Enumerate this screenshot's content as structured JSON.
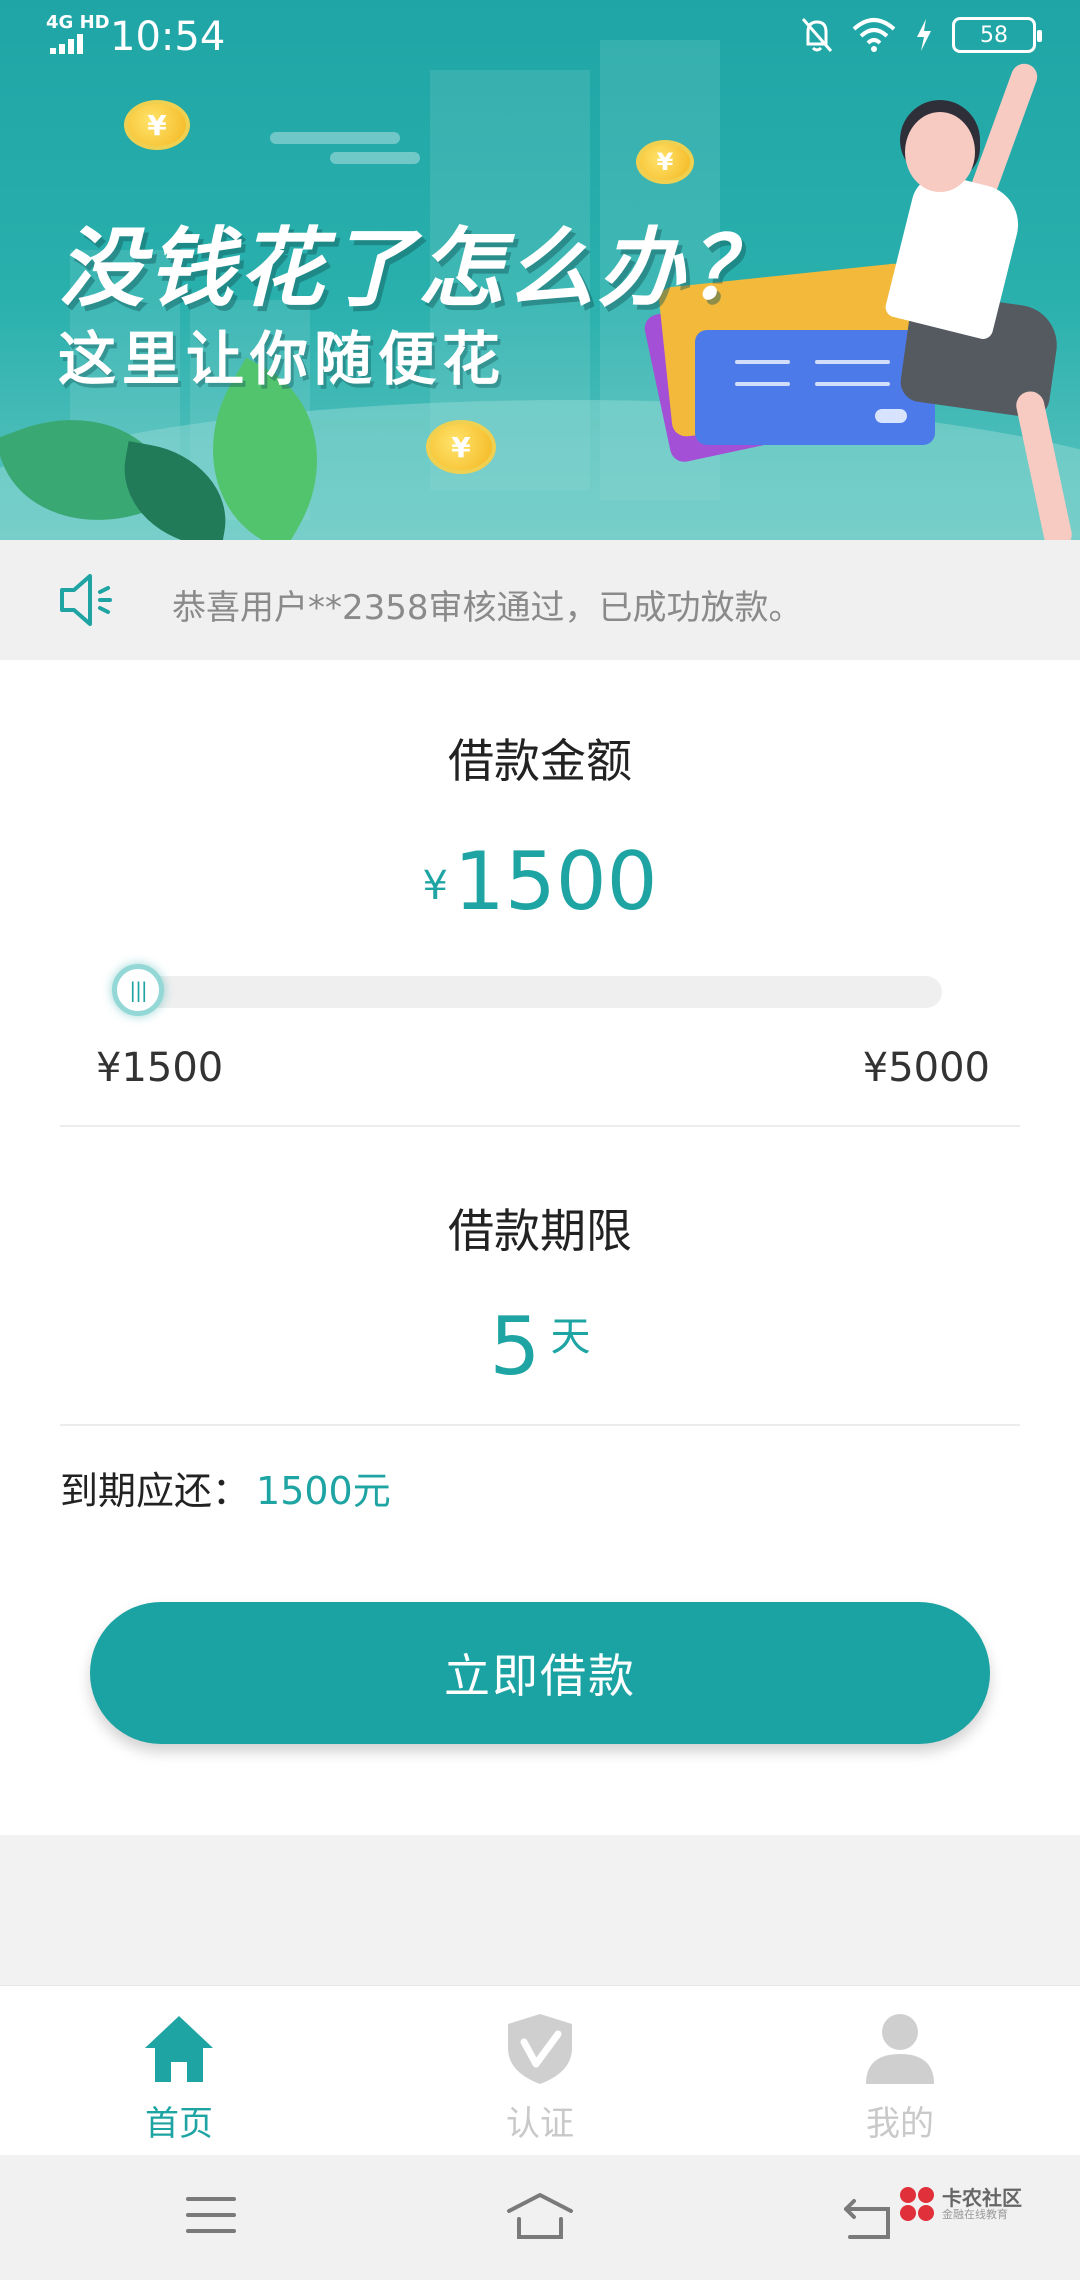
{
  "status_bar": {
    "network": "4G HD",
    "time": "10:54",
    "battery": "58"
  },
  "banner": {
    "headline": "没钱花了怎么办？",
    "subline": "这里让你随便花",
    "coin_symbol": "¥"
  },
  "notice": {
    "icon": "speaker-icon",
    "text": "恭喜用户**2358审核通过，已成功放款。"
  },
  "loan": {
    "amount_title": "借款金额",
    "currency": "¥",
    "amount": "1500",
    "slider_value_fraction": 0,
    "range_min": "¥1500",
    "range_max": "¥5000",
    "term_title": "借款期限",
    "term_value": "5",
    "term_unit": "天",
    "due_label": "到期应还：",
    "due_value": "1500元",
    "cta_label": "立即借款"
  },
  "tabbar": {
    "items": [
      {
        "label": "首页",
        "icon": "home-icon",
        "active": true
      },
      {
        "label": "认证",
        "icon": "shield-check-icon",
        "active": false
      },
      {
        "label": "我的",
        "icon": "user-icon",
        "active": false
      }
    ]
  },
  "system_nav": {
    "watermark_title": "卡农社区",
    "watermark_sub": "金融在线教育"
  },
  "colors": {
    "accent": "#1ea4a3",
    "banner": "#29b0ad",
    "inactive_tab": "#c9c9c9",
    "notice_bg": "#f0f0f0"
  }
}
